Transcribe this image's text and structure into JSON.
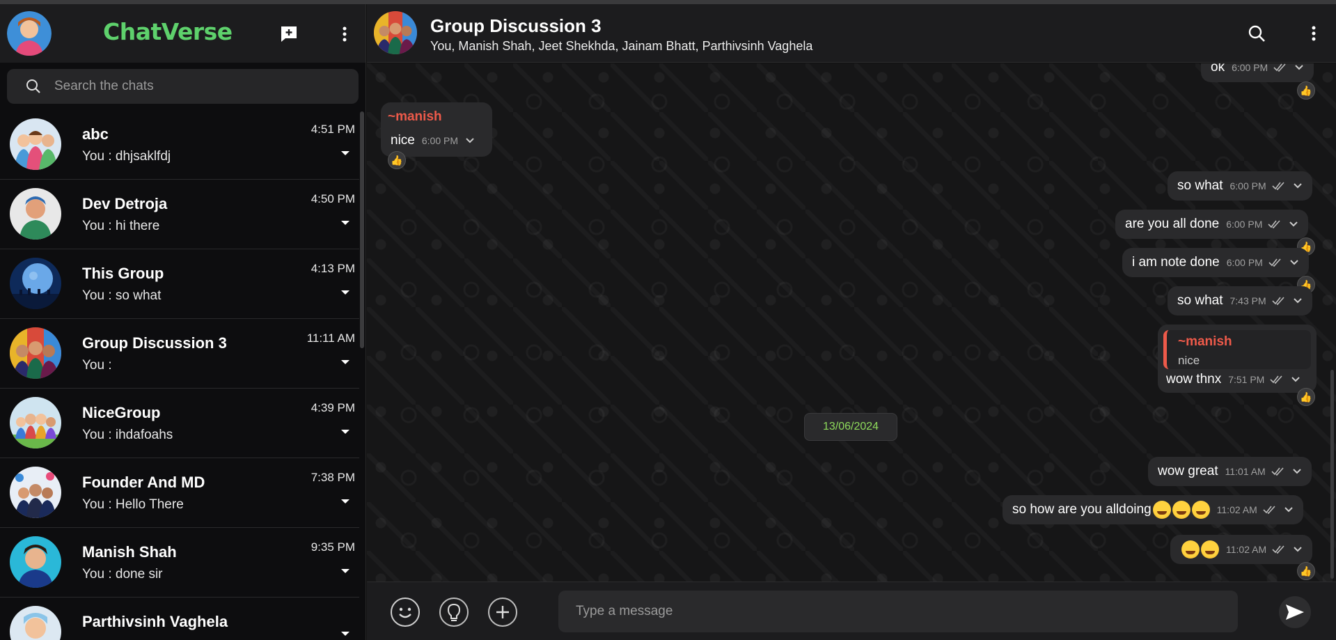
{
  "app": {
    "brand": "ChatVerse"
  },
  "sidebar": {
    "search_placeholder": "Search the chats",
    "chats": [
      {
        "name": "abc",
        "last": "You : dhjsaklfdj",
        "time": "4:51 PM"
      },
      {
        "name": "Dev Detroja",
        "last": "You : hi there",
        "time": "4:50 PM"
      },
      {
        "name": "This Group",
        "last": "You : so what",
        "time": "4:13 PM"
      },
      {
        "name": "Group Discussion 3",
        "last": "You :",
        "time": "11:11 AM"
      },
      {
        "name": "NiceGroup",
        "last": "You : ihdafoahs",
        "time": "4:39 PM"
      },
      {
        "name": "Founder And MD",
        "last": "You : Hello There",
        "time": "7:38 PM"
      },
      {
        "name": "Manish Shah",
        "last": "You : done sir",
        "time": "9:35 PM"
      },
      {
        "name": "Parthivsinh Vaghela",
        "last": "",
        "time": ""
      }
    ]
  },
  "conversation": {
    "title": "Group Discussion 3",
    "members": "You, Manish Shah, Jeet Shekhda, Jainam Bhatt, Parthivsinh Vaghela",
    "messages": {
      "m1": {
        "text": "ok",
        "time": "6:00 PM"
      },
      "m2": {
        "sender": "~manish",
        "text": "nice",
        "time": "6:00 PM"
      },
      "m3": {
        "text": "so what",
        "time": "6:00 PM"
      },
      "m4": {
        "text": "are you all done",
        "time": "6:00 PM"
      },
      "m5": {
        "text": "i am note done",
        "time": "6:00 PM"
      },
      "m6": {
        "text": "so what",
        "time": "7:43 PM"
      },
      "m7": {
        "quote_sender": "~manish",
        "quote_text": "nice",
        "text": "wow thnx",
        "time": "7:51 PM"
      },
      "date": "13/06/2024",
      "m8": {
        "text": "wow great",
        "time": "11:01 AM"
      },
      "m9": {
        "text": "so how are you alldoing",
        "time": "11:02 AM"
      },
      "m10": {
        "text": "",
        "time": "11:02 AM"
      }
    },
    "reaction_glyph": "👍"
  },
  "composer": {
    "placeholder": "Type a message"
  },
  "colors": {
    "brand": "#5ed16c",
    "sender": "#ee5a4a",
    "date": "#8fdc5c"
  }
}
